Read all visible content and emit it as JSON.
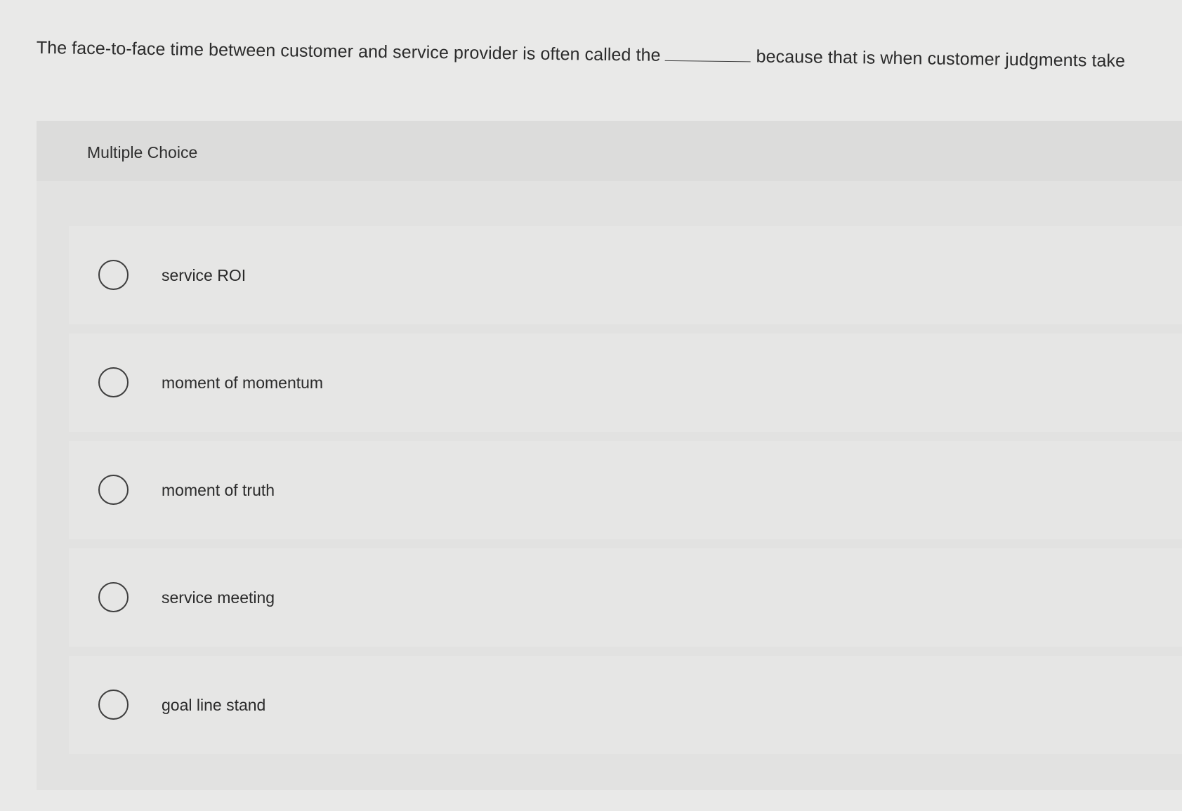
{
  "question": {
    "text_before": "The face-to-face time between customer and service provider is often called the",
    "text_after": "because that is when customer judgments take"
  },
  "panel": {
    "title": "Multiple Choice"
  },
  "options": [
    {
      "label": "service ROI",
      "selected": false
    },
    {
      "label": "moment of momentum",
      "selected": false
    },
    {
      "label": "moment of truth",
      "selected": false
    },
    {
      "label": "service meeting",
      "selected": false
    },
    {
      "label": "goal line stand",
      "selected": false
    }
  ]
}
